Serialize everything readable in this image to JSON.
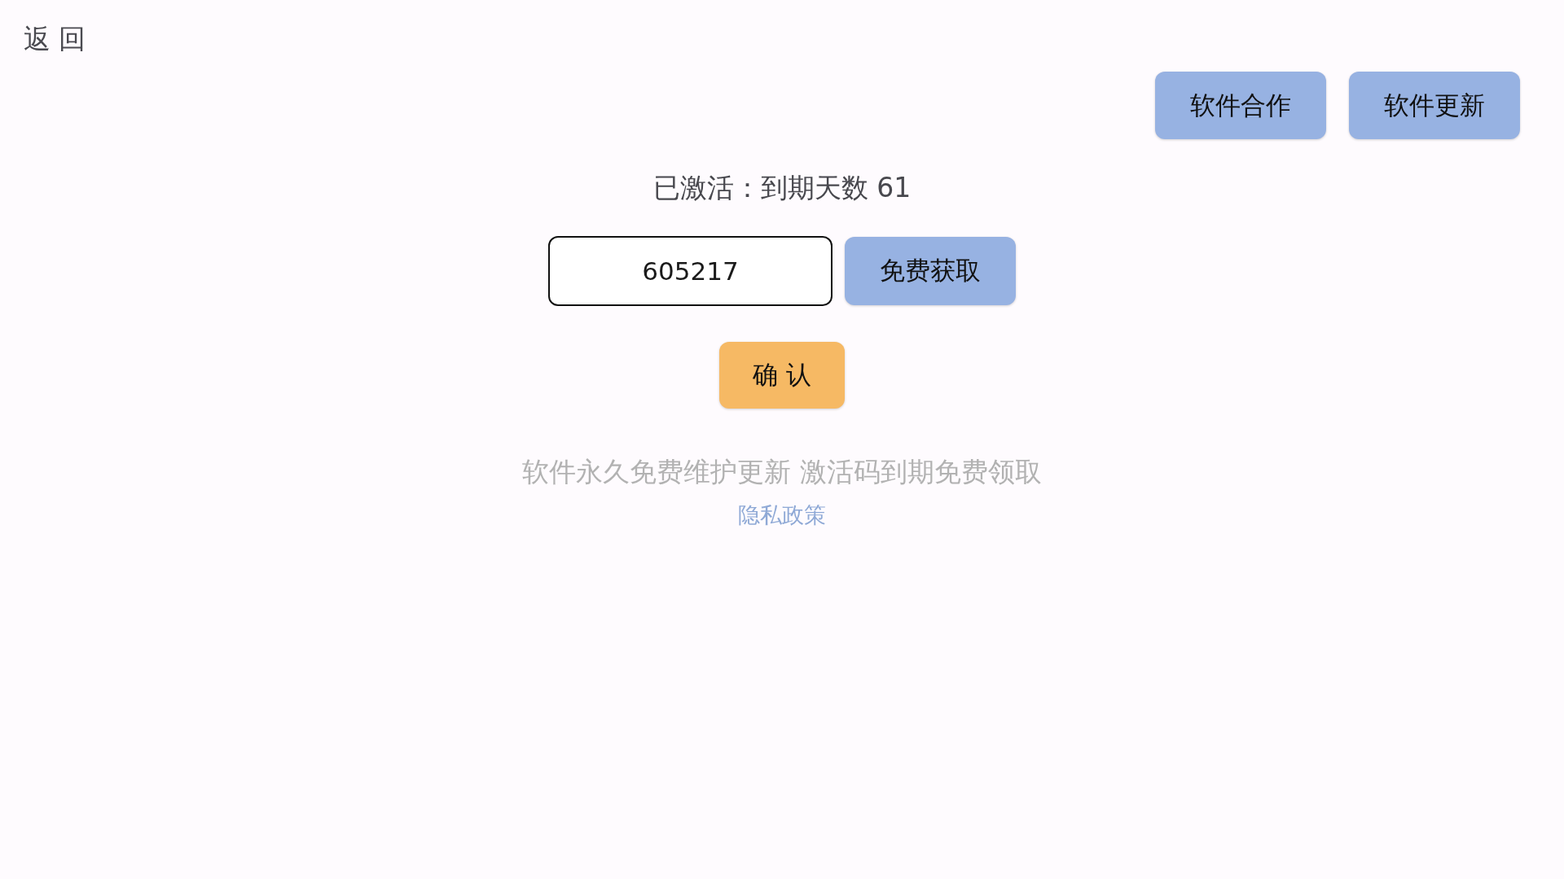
{
  "back_link": "返 回",
  "top_buttons": [
    "软件合作",
    "软件更新"
  ],
  "status": "已激活：到期天数 61",
  "code_input": {
    "value": "605217"
  },
  "get_free_button": "免费获取",
  "confirm_button": "确 认",
  "notice": "软件永久免费维护更新 激活码到期免费领取",
  "privacy_link": "隐私政策"
}
